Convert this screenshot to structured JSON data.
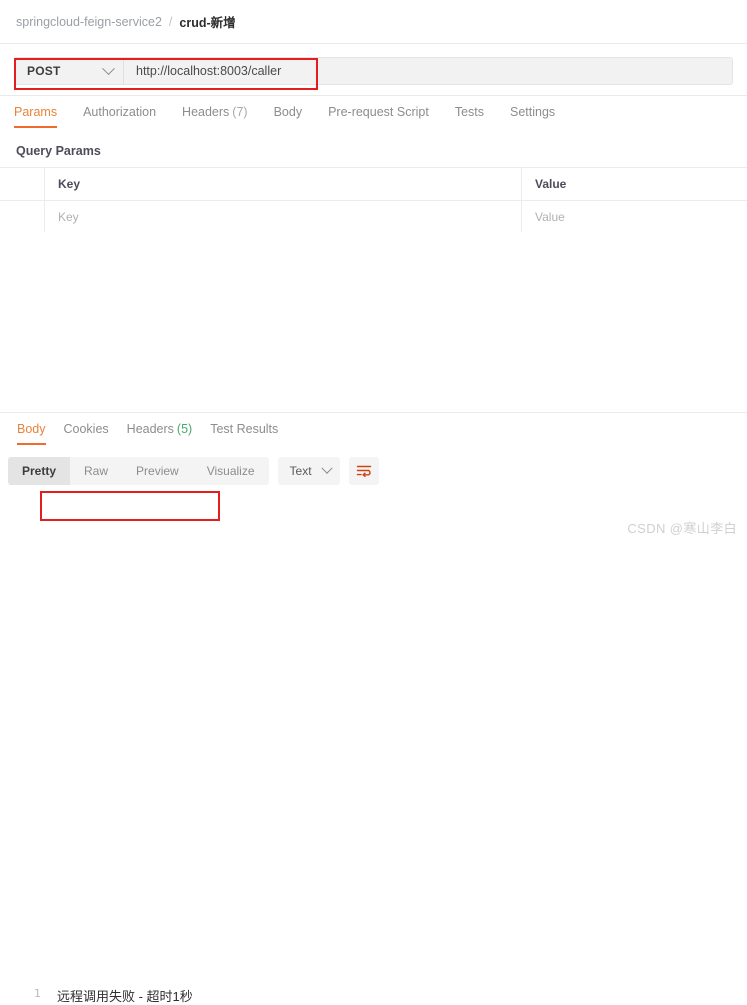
{
  "breadcrumb": {
    "collection": "springcloud-feign-service2",
    "separator": "/",
    "request": "crud-新增"
  },
  "url_bar": {
    "method": "POST",
    "method_icon": "chevron-down-icon",
    "url_value": "http://localhost:8003/caller",
    "url_placeholder": "Enter request URL",
    "annotation_color": "#e41e1e"
  },
  "request_tabs": [
    {
      "label": "Params",
      "count": "",
      "active": true
    },
    {
      "label": "Authorization",
      "count": "",
      "active": false
    },
    {
      "label": "Headers",
      "count": "(7)",
      "active": false
    },
    {
      "label": "Body",
      "count": "",
      "active": false
    },
    {
      "label": "Pre-request Script",
      "count": "",
      "active": false
    },
    {
      "label": "Tests",
      "count": "",
      "active": false
    },
    {
      "label": "Settings",
      "count": "",
      "active": false
    }
  ],
  "query_params": {
    "section_title": "Query Params",
    "columns": [
      "Key",
      "Value"
    ],
    "rows": [
      {
        "key_placeholder": "Key",
        "value_placeholder": "Value"
      }
    ]
  },
  "response_tabs": [
    {
      "label": "Body",
      "count": "",
      "active": true
    },
    {
      "label": "Cookies",
      "count": "",
      "active": false
    },
    {
      "label": "Headers",
      "count": "(5)",
      "active": false
    },
    {
      "label": "Test Results",
      "count": "",
      "active": false
    }
  ],
  "format_bar": {
    "views": [
      {
        "label": "Pretty",
        "active": true
      },
      {
        "label": "Raw",
        "active": false
      },
      {
        "label": "Preview",
        "active": false
      },
      {
        "label": "Visualize",
        "active": false
      }
    ],
    "language": "Text",
    "language_icon": "chevron-down-icon",
    "wrap_icon": "wrap-text-icon",
    "wrap_icon_color": "#cc4415"
  },
  "response_body": {
    "line_number": "1",
    "content": "远程调用失败 - 超时1秒",
    "annotation_color": "#e41e1e"
  },
  "watermark": {
    "text": "CSDN @寒山李白"
  }
}
